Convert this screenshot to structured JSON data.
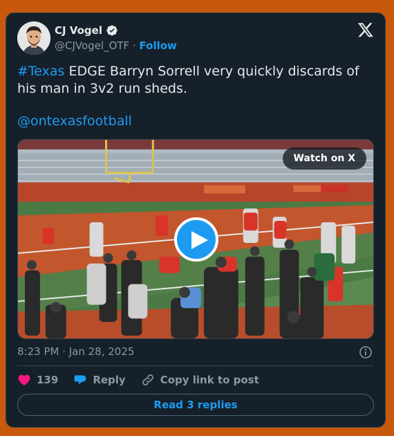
{
  "author": {
    "name": "CJ Vogel",
    "handle": "@CJVogel_OTF",
    "separator": "·",
    "follow_label": "Follow"
  },
  "tweet": {
    "hashtag": "#Texas",
    "text_rest": " EDGE Barryn Sorrell very quickly discards of his man in 3v2 run sheds.",
    "mention": "@ontexasfootball"
  },
  "media": {
    "watch_label": "Watch on X",
    "play_state": "paused"
  },
  "meta": {
    "timestamp": "8:23 PM · Jan 28, 2025"
  },
  "actions": {
    "like_count": "139",
    "reply_label": "Reply",
    "copy_label": "Copy link to post"
  },
  "read_replies_label": "Read 3 replies",
  "colors": {
    "accent": "#1d9bf0",
    "like": "#f91880",
    "card_bg": "#15202b",
    "page_bg": "#c8580c"
  }
}
